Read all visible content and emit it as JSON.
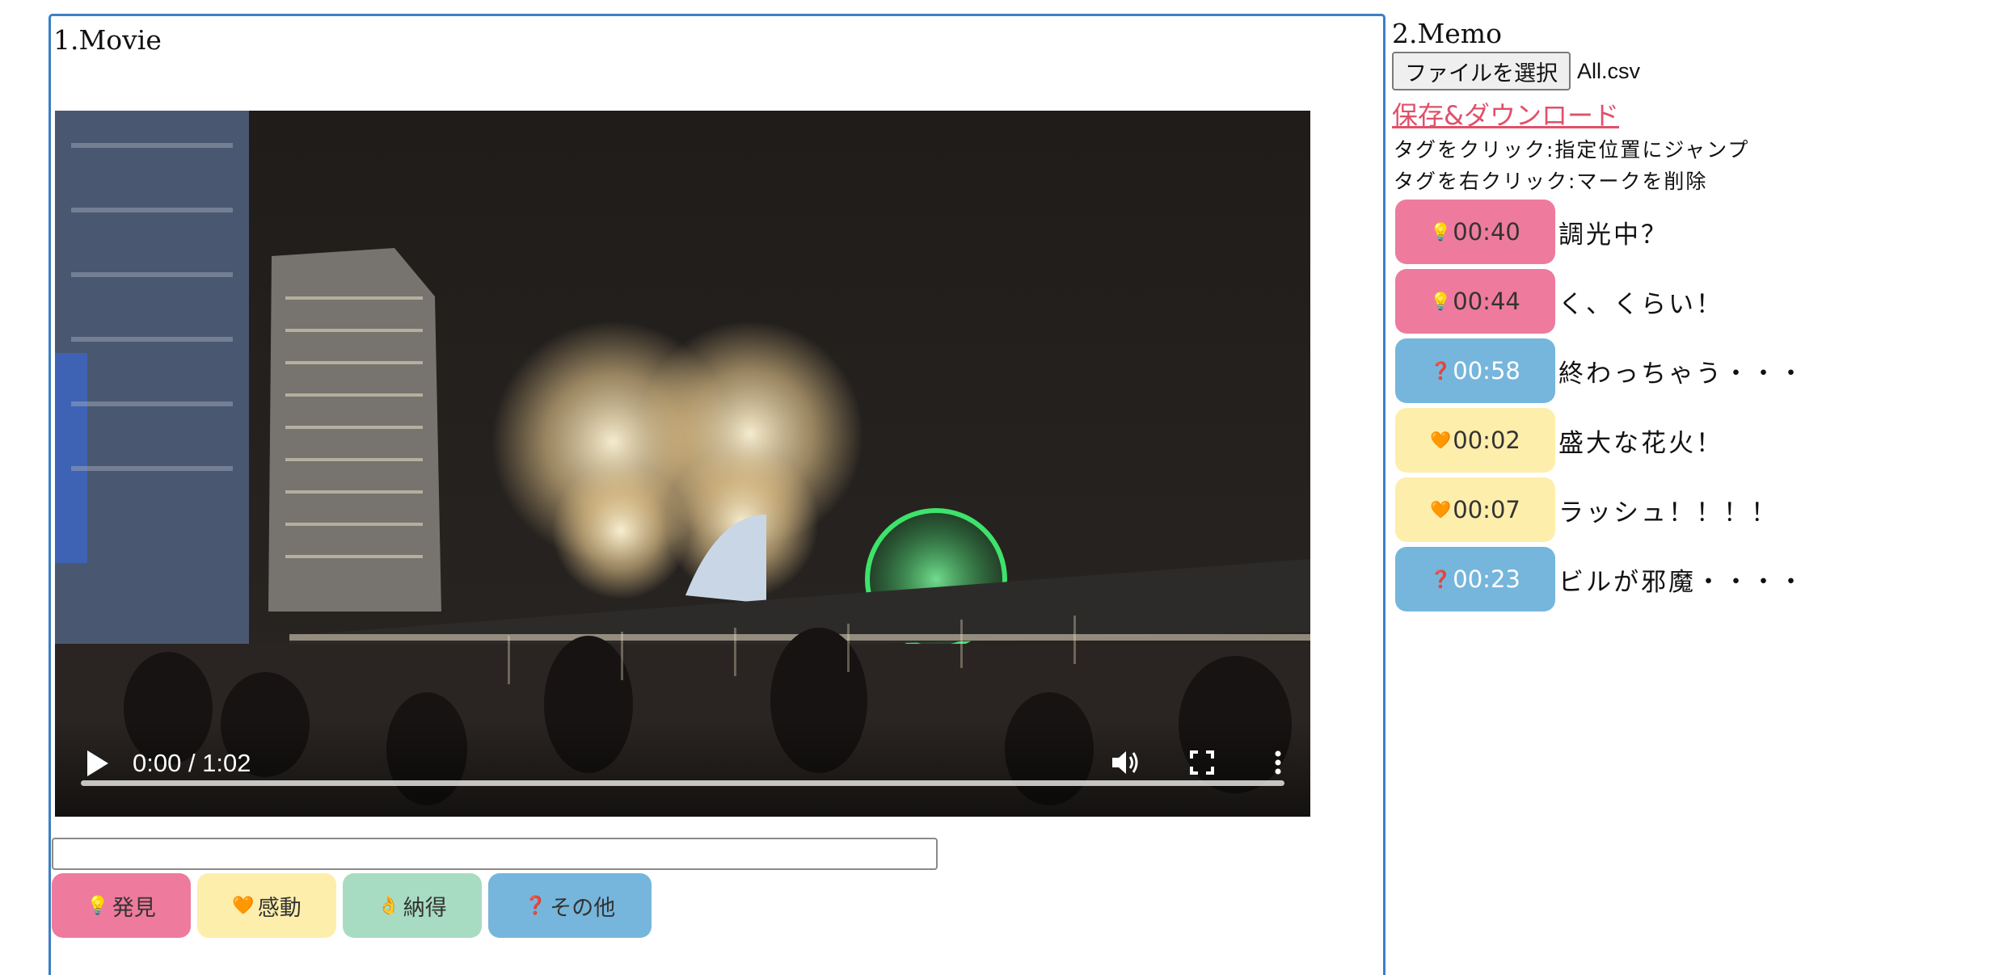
{
  "movie": {
    "title": "1.Movie",
    "player": {
      "time": "0:00 / 1:02",
      "progress": 0.0
    },
    "memo_input": {
      "value": "",
      "placeholder": ""
    },
    "buttons": [
      {
        "emoji": "💡",
        "label": "発見",
        "color": "#ee7b9e"
      },
      {
        "emoji": "🧡",
        "label": "感動",
        "color": "#fdeeab"
      },
      {
        "emoji": "👌",
        "label": "納得",
        "color": "#a8dcc2"
      },
      {
        "emoji": "❓",
        "label": "その他",
        "color": "#76b6dc"
      }
    ]
  },
  "memo": {
    "title": "2.Memo",
    "file_button": "ファイルを選択",
    "file_name": "All.csv",
    "save_link": "保存&ダウンロード",
    "help": [
      "タグをクリック:指定位置にジャンプ",
      "タグを右クリック:マークを削除"
    ],
    "entries": [
      {
        "emoji": "💡",
        "time": "00:40",
        "text": "調光中？",
        "color": "#ee7b9e",
        "text_color": "#333"
      },
      {
        "emoji": "💡",
        "time": "00:44",
        "text": "く、くらい！",
        "color": "#ee7b9e",
        "text_color": "#333"
      },
      {
        "emoji": "❓",
        "time": "00:58",
        "text": "終わっちゃう・・・",
        "color": "#76b6dc",
        "text_color": "#ffffff"
      },
      {
        "emoji": "🧡",
        "time": "00:02",
        "text": "盛大な花火！",
        "color": "#fdeeab",
        "text_color": "#333"
      },
      {
        "emoji": "🧡",
        "time": "00:07",
        "text": "ラッシュ！！！！",
        "color": "#fdeeab",
        "text_color": "#333"
      },
      {
        "emoji": "❓",
        "time": "00:23",
        "text": "ビルが邪魔・・・・",
        "color": "#76b6dc",
        "text_color": "#ffffff"
      }
    ]
  }
}
